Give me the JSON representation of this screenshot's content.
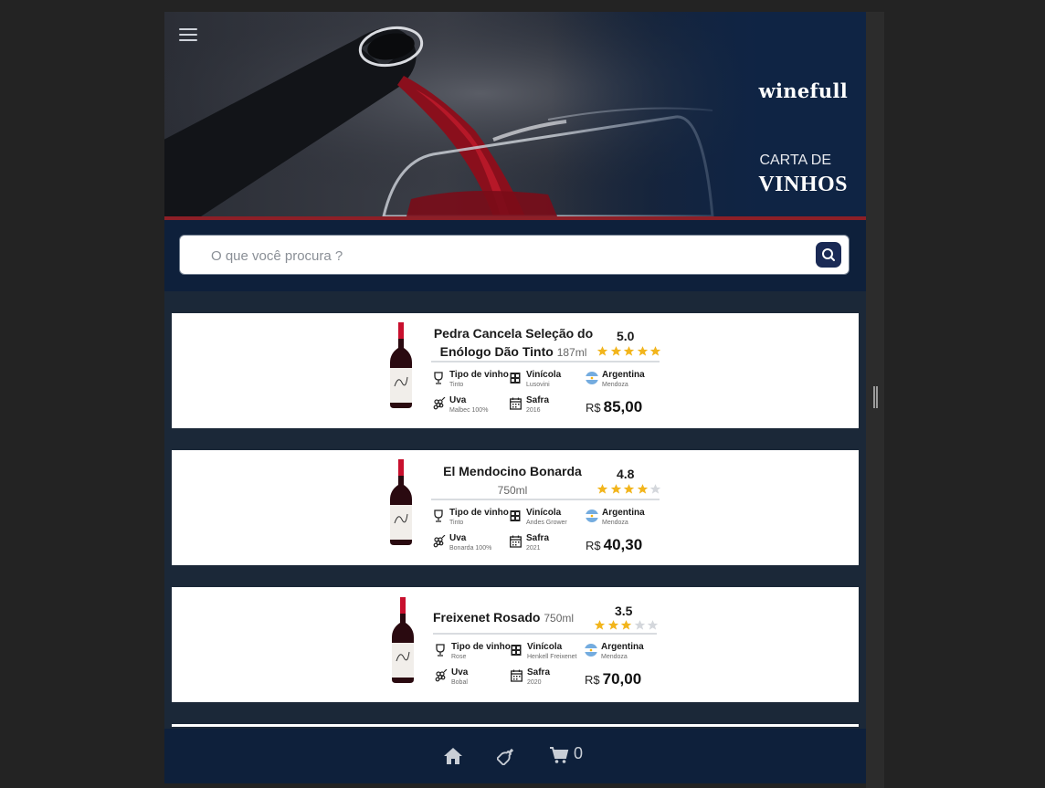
{
  "header": {
    "brand": "winefull",
    "subtitle_top": "CARTA DE",
    "subtitle_bottom": "VINHOS",
    "menu_icon": "hamburger-menu-icon"
  },
  "search": {
    "placeholder": "O que você procura ?",
    "value": "",
    "icon": "search-icon"
  },
  "labels": {
    "wine_type": "Tipo de vinho",
    "winery": "Vinícola",
    "grape": "Uva",
    "vintage": "Safra",
    "currency": "R$"
  },
  "wines": [
    {
      "name": "Pedra Cancela Seleção do Enólogo Dão Tinto",
      "volume": "187ml",
      "rating": "5.0",
      "rating_value": 5.0,
      "type": "Tinto",
      "winery": "Lusovini",
      "country": "Argentina",
      "region": "Mendoza",
      "grape": "Malbec 100%",
      "vintage": "2016",
      "price": "85,00"
    },
    {
      "name": "El Mendocino Bonarda",
      "volume": "750ml",
      "rating": "4.8",
      "rating_value": 4.0,
      "type": "Tinto",
      "winery": "Andes Grower",
      "country": "Argentina",
      "region": "Mendoza",
      "grape": "Bonarda 100%",
      "vintage": "2021",
      "price": "40,30"
    },
    {
      "name": "Freixenet Rosado",
      "volume": "750ml",
      "rating": "3.5",
      "rating_value": 3.0,
      "type": "Rose",
      "winery": "Henkell Freixenet",
      "country": "Argentina",
      "region": "Mendoza",
      "grape": "Bobal",
      "vintage": "2020",
      "price": "70,00"
    }
  ],
  "bottom_nav": {
    "cart_count": "0",
    "items": [
      "home-icon",
      "wine-bottle-icon",
      "shopping-cart-icon"
    ]
  },
  "colors": {
    "header_bg": "#0e203b",
    "accent_red": "#8d1f27",
    "star_gold": "#f2b51c",
    "star_empty": "#d4d7dc",
    "search_button": "#1a2a55"
  }
}
